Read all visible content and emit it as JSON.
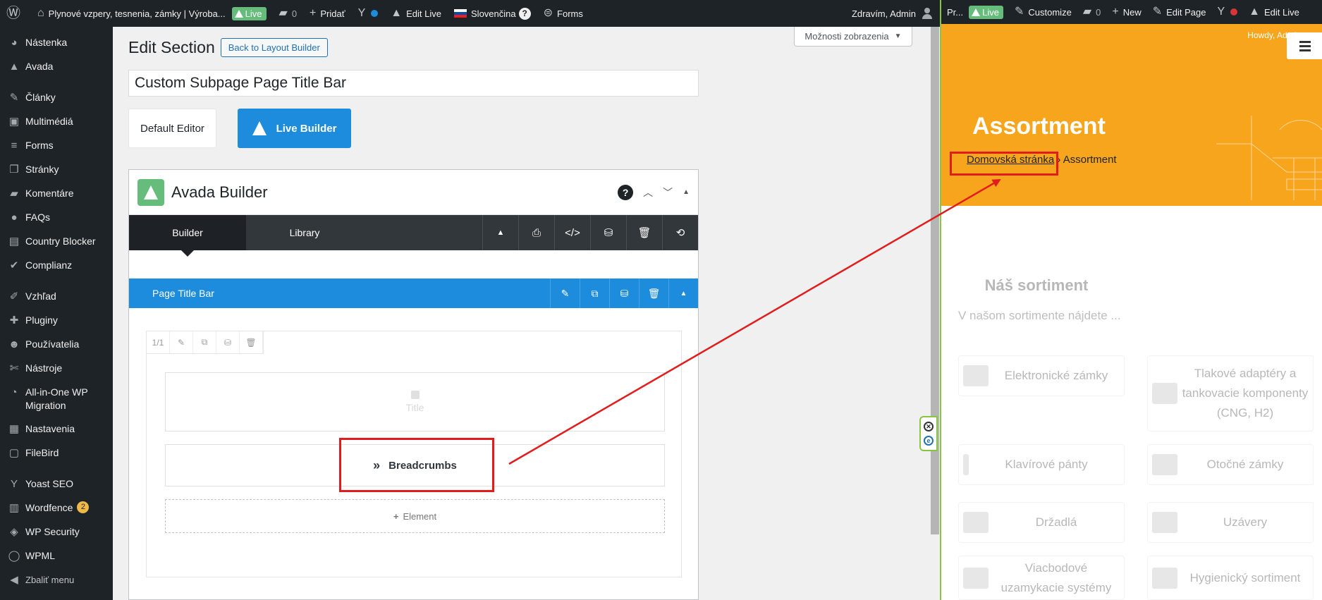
{
  "adminbar": {
    "site_title": "Plynové vzpery, tesnenia, zámky | Výroba...",
    "live": "Live",
    "comments_count": "0",
    "add_new": "Pridať",
    "edit_live": "Edit Live",
    "language": "Slovenčina",
    "language_help": "?",
    "forms": "Forms",
    "greeting": "Zdravím, Admin"
  },
  "sidebar": {
    "items": [
      {
        "label": "Nástenka",
        "icon": "dashboard-icon",
        "glyph": "◕"
      },
      {
        "label": "Avada",
        "icon": "avada-icon",
        "glyph": "▲"
      },
      {
        "label": "Články",
        "icon": "pin-icon",
        "glyph": "✎"
      },
      {
        "label": "Multimédiá",
        "icon": "media-icon",
        "glyph": "▣"
      },
      {
        "label": "Forms",
        "icon": "forms-icon",
        "glyph": "≡"
      },
      {
        "label": "Stránky",
        "icon": "pages-icon",
        "glyph": "❐"
      },
      {
        "label": "Komentáre",
        "icon": "comments-icon",
        "glyph": "▰"
      },
      {
        "label": "FAQs",
        "icon": "faq-icon",
        "glyph": "●"
      },
      {
        "label": "Country Blocker",
        "icon": "country-blocker-icon",
        "glyph": "▤"
      },
      {
        "label": "Complianz",
        "icon": "check-icon",
        "glyph": "✔"
      },
      {
        "label": "Vzhľad",
        "icon": "appearance-icon",
        "glyph": "✐"
      },
      {
        "label": "Pluginy",
        "icon": "plugins-icon",
        "glyph": "✚"
      },
      {
        "label": "Používatelia",
        "icon": "users-icon",
        "glyph": "☻"
      },
      {
        "label": "Nástroje",
        "icon": "tools-icon",
        "glyph": "✄"
      },
      {
        "label": "All-in-One WP Migration",
        "icon": "migration-icon",
        "glyph": "◔"
      },
      {
        "label": "Nastavenia",
        "icon": "settings-icon",
        "glyph": "▦"
      },
      {
        "label": "FileBird",
        "icon": "filebird-icon",
        "glyph": "▢"
      },
      {
        "label": "Yoast SEO",
        "icon": "yoast-icon",
        "glyph": "Y"
      },
      {
        "label": "Wordfence",
        "icon": "wordfence-icon",
        "glyph": "▥",
        "badge": "2"
      },
      {
        "label": "WP Security",
        "icon": "shield-icon",
        "glyph": "◈"
      },
      {
        "label": "WPML",
        "icon": "wpml-icon",
        "glyph": "◯"
      },
      {
        "label": "Zbaliť menu",
        "icon": "collapse-icon",
        "glyph": "◀"
      }
    ]
  },
  "main": {
    "screen_options": "Možnosti zobrazenia",
    "page_title": "Edit Section",
    "back_button": "Back to Layout Builder",
    "post_title": "Custom Subpage Page Title Bar",
    "default_editor": "Default Editor",
    "live_builder": "Live Builder"
  },
  "builder": {
    "title": "Avada Builder",
    "help": "?",
    "tabs": [
      "Builder",
      "Library"
    ],
    "section_name": "Page Title Bar",
    "column_size": "1/1",
    "elements": {
      "title": "Title",
      "breadcrumbs": "Breadcrumbs",
      "add": "Element"
    }
  },
  "preview": {
    "bar": {
      "truncated": "Pr...",
      "live": "Live",
      "customize": "Customize",
      "comments_count": "0",
      "new": "New",
      "edit_page": "Edit Page",
      "edit_live": "Edit Live"
    },
    "howdy": "Howdy, Admin",
    "hero_title": "Assortment",
    "crumb_home": "Domovská stránka",
    "crumb_sep": "›",
    "crumb_current": "Assortment",
    "section_heading": "Náš sortiment",
    "section_text": "V našom sortimente nájdete ...",
    "cards": [
      "Elektronické zámky",
      "Tlakové adaptéry a tankovacie komponenty (CNG, H2)",
      "Klavírové pánty",
      "Otočné zámky",
      "Držadlá",
      "Uzávery",
      "Viacbodové uzamykacie systémy",
      "Hygienický sortiment"
    ]
  },
  "colors": {
    "wp_dark": "#1d2327",
    "avada_blue": "#1e8cdd",
    "avada_green": "#65bc7b",
    "hero_orange": "#f7a51d",
    "annotation_red": "#e21c1c"
  }
}
